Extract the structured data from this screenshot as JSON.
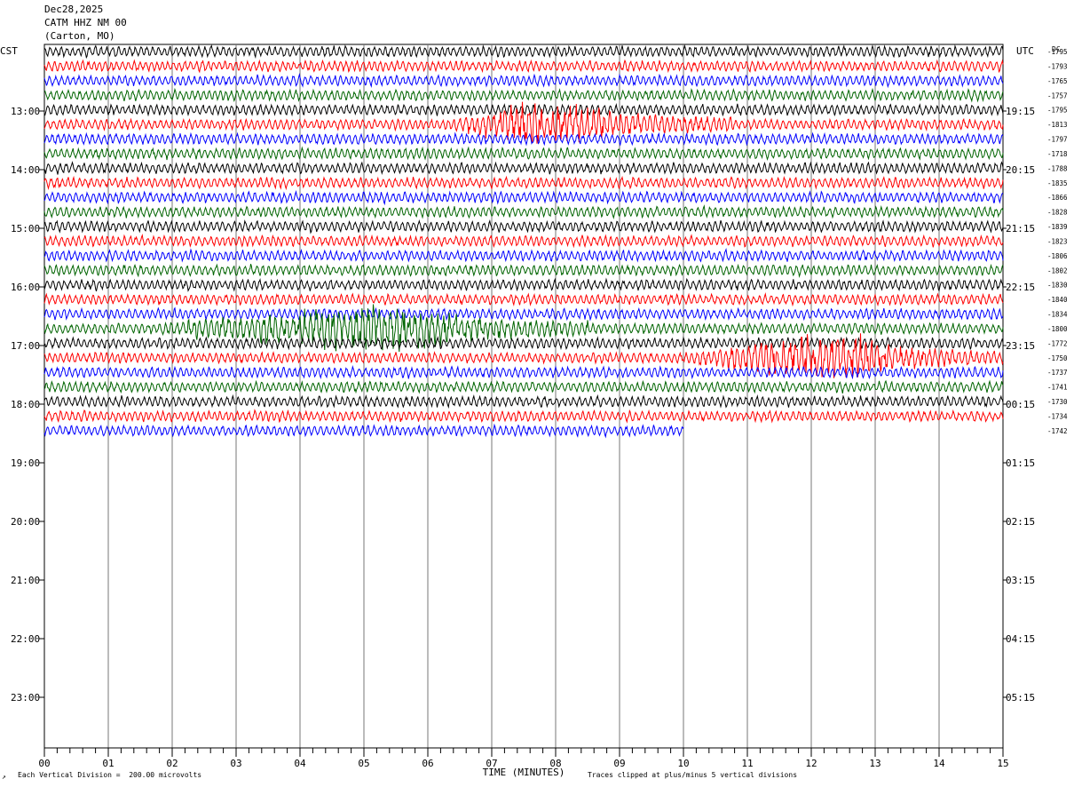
{
  "header": {
    "date": "Dec28,2025",
    "station": "CATM HHZ NM 00",
    "location": "(Carton, MO)"
  },
  "footer": {
    "scale_note": "Each Vertical Division =  200.00 microvolts",
    "clip_note": "Traces clipped at plus/minus 5 vertical divisions",
    "corner_mark": "↗"
  },
  "chart_data": {
    "type": "line",
    "title": "",
    "xlabel": "TIME (MINUTES)",
    "ylabel": "",
    "left_axis_label": "CST",
    "right_axis_label": "UTC",
    "dc_label": "DC",
    "xlim": [
      0,
      15
    ],
    "x_ticks": [
      "00",
      "01",
      "02",
      "03",
      "04",
      "05",
      "06",
      "07",
      "08",
      "09",
      "10",
      "11",
      "12",
      "13",
      "14",
      "15"
    ],
    "left_hour_labels": [
      "13:00",
      "14:00",
      "15:00",
      "16:00",
      "17:00",
      "18:00",
      "19:00",
      "20:00",
      "21:00",
      "22:00",
      "23:00"
    ],
    "right_hour_labels": [
      "19:15",
      "20:15",
      "21:15",
      "22:15",
      "23:15",
      "00:15",
      "01:15",
      "02:15",
      "03:15",
      "04:15",
      "05:15"
    ],
    "trace_colors": [
      "#000000",
      "#ff0000",
      "#0000ff",
      "#006400"
    ],
    "dc_offsets": [
      "-1795",
      "-1793",
      "-1765",
      "-1757",
      "-1795",
      "-1813",
      "-1797",
      "-1718",
      "-1788",
      "-1835",
      "-1866",
      "-1828",
      "-1839",
      "-1823",
      "-1806",
      "-1802",
      "-1830",
      "-1840",
      "-1834",
      "-1800",
      "-1772",
      "-1750",
      "-1737",
      "-1741",
      "-1730",
      "-1734",
      "-1742"
    ],
    "trace_count": 27,
    "last_trace_end_minute": 10,
    "grid": true,
    "events": [
      {
        "trace_index": 5,
        "start_minute": 6.3,
        "end_minute": 10.8,
        "peak_minute": 7.8
      },
      {
        "trace_index": 19,
        "start_minute": 1.5,
        "end_minute": 8.5,
        "peak_minute": 5.5
      },
      {
        "trace_index": 21,
        "start_minute": 10.0,
        "end_minute": 14.9,
        "peak_minute": 12.5
      }
    ]
  }
}
